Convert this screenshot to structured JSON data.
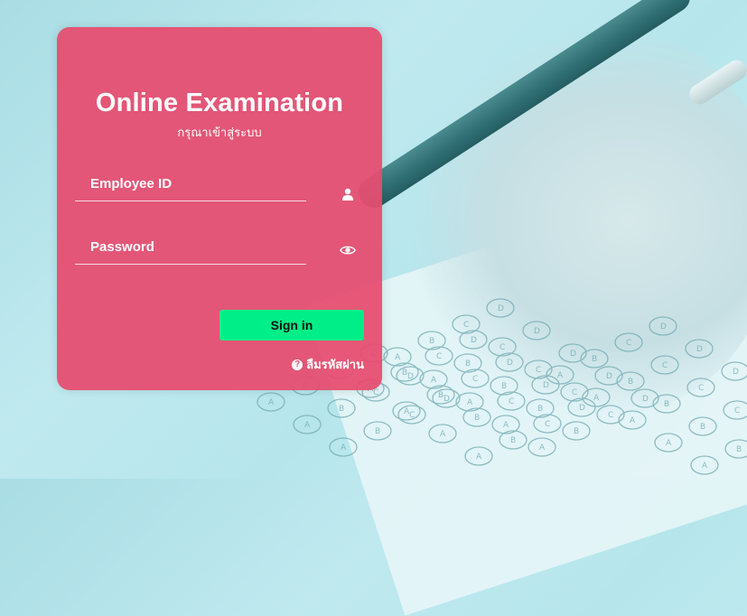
{
  "login": {
    "title": "Online Examination",
    "subtitle": "กรุณาเข้าสู่ระบบ",
    "employee_placeholder": "Employee ID",
    "password_placeholder": "Password",
    "signin_label": "Sign in",
    "forgot_label": "ลืมรหัสผ่าน"
  },
  "colors": {
    "card": "#e54c70",
    "signin_button": "#00ee87",
    "text": "#ffffff"
  },
  "icons": {
    "employee_field": "user-icon",
    "password_field": "eye-icon",
    "forgot": "question-circle-icon"
  },
  "background": {
    "bubble_letters": [
      "A",
      "B",
      "C",
      "D"
    ]
  }
}
